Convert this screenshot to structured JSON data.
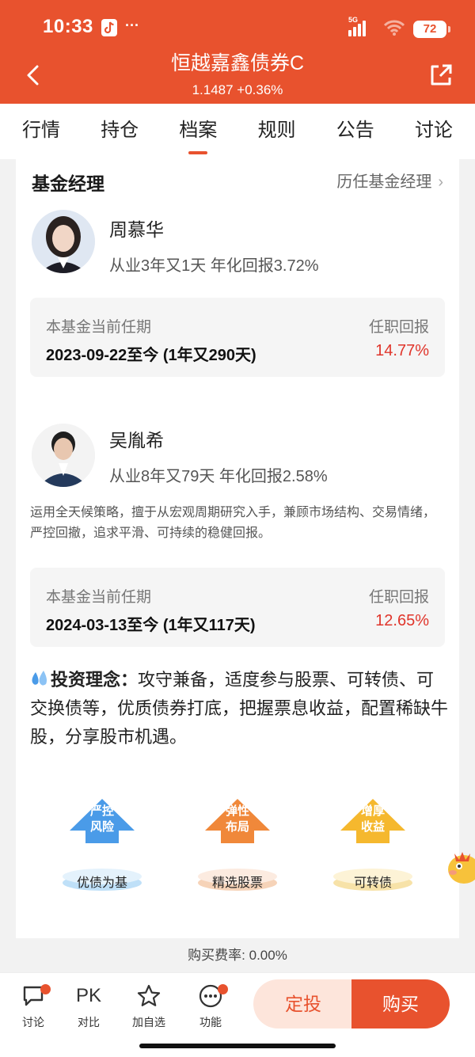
{
  "status": {
    "time": "10:33",
    "dots": "···",
    "network": "5G",
    "battery": "72"
  },
  "header": {
    "title": "恒越嘉鑫债券C",
    "subtitle": "1.1487 +0.36%"
  },
  "tabs": [
    "行情",
    "持仓",
    "档案",
    "规则",
    "公告",
    "讨论"
  ],
  "managers_section": {
    "title": "基金经理",
    "history_link": "历任基金经理"
  },
  "managers": [
    {
      "name": "周慕华",
      "stat": "从业3年又1天 年化回报3.72%",
      "tenure_label": "本基金当前任期",
      "return_label": "任职回报",
      "tenure": "2023-09-22至今 (1年又290天)",
      "return": "14.77%"
    },
    {
      "name": "吴胤希",
      "stat": "从业8年又79天 年化回报2.58%",
      "desc": "运用全天候策略，擅于从宏观周期研究入手，兼顾市场结构、交易情绪，严控回撤，追求平滑、可持续的稳健回报。",
      "tenure_label": "本基金当前任期",
      "return_label": "任职回报",
      "tenure": "2024-03-13至今 (1年又117天)",
      "return": "12.65%"
    }
  ],
  "philosophy": {
    "label": "投资理念：",
    "text": "攻守兼备，适度参与股票、可转债、可交换债等，优质债券打底，把握票息收益，配置稀缺牛股，分享股市机遇。"
  },
  "arrows": [
    {
      "inner": "严控风险",
      "caption": "优债为基",
      "color": "#4a9be8"
    },
    {
      "inner": "弹性布局",
      "caption": "精选股票",
      "color": "#f0883a"
    },
    {
      "inner": "增厚收益",
      "caption": "可转债",
      "color": "#f5b82e"
    }
  ],
  "fee": "购买费率: 0.00%",
  "bottom_nav": [
    {
      "icon": "discuss-icon",
      "label": "讨论"
    },
    {
      "icon": "pk-icon",
      "glyph": "PK",
      "label": "对比"
    },
    {
      "icon": "star-icon",
      "label": "加自选"
    },
    {
      "icon": "more-icon",
      "label": "功能"
    }
  ],
  "buttons": {
    "dingtou": "定投",
    "buy": "购买"
  }
}
